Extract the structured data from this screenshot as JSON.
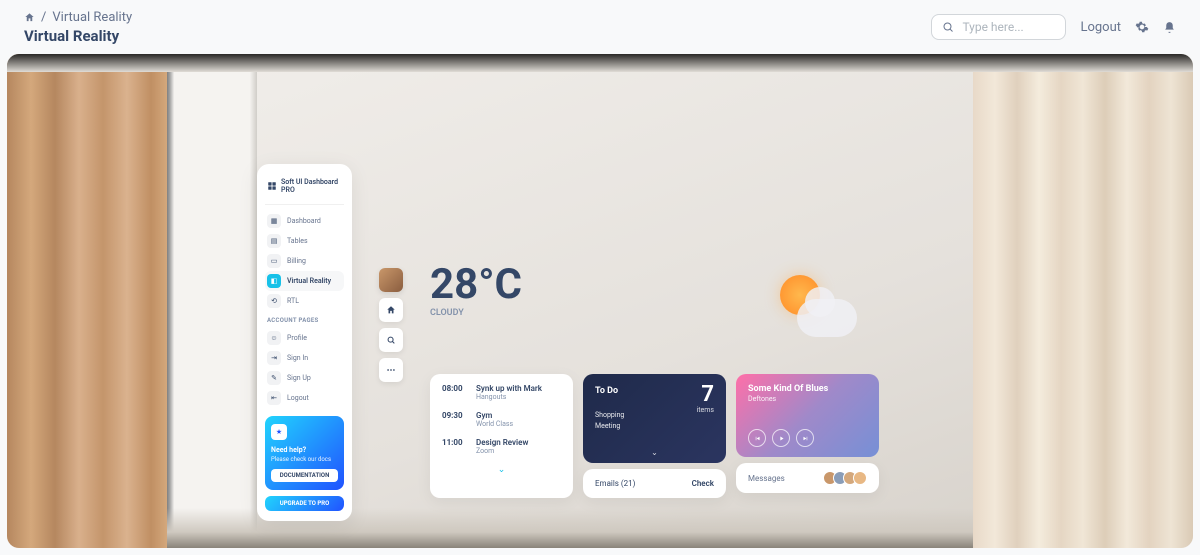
{
  "header": {
    "breadcrumb_current": "Virtual Reality",
    "page_title": "Virtual Reality",
    "search_placeholder": "Type here...",
    "logout": "Logout"
  },
  "sidebar": {
    "brand": "Soft UI Dashboard PRO",
    "items": [
      {
        "label": "Dashboard"
      },
      {
        "label": "Tables"
      },
      {
        "label": "Billing"
      },
      {
        "label": "Virtual Reality"
      },
      {
        "label": "RTL"
      }
    ],
    "account_heading": "ACCOUNT PAGES",
    "account_items": [
      {
        "label": "Profile"
      },
      {
        "label": "Sign In"
      },
      {
        "label": "Sign Up"
      },
      {
        "label": "Logout"
      }
    ],
    "help": {
      "title": "Need help?",
      "subtitle": "Please check our docs",
      "doc_btn": "DOCUMENTATION"
    },
    "upgrade": "UPGRADE TO PRO"
  },
  "weather": {
    "temperature": "28°C",
    "condition": "CLOUDY"
  },
  "schedule": [
    {
      "time": "08:00",
      "title": "Synk up with Mark",
      "sub": "Hangouts"
    },
    {
      "time": "09:30",
      "title": "Gym",
      "sub": "World Class"
    },
    {
      "time": "11:00",
      "title": "Design Review",
      "sub": "Zoom"
    }
  ],
  "todo": {
    "title": "To Do",
    "count": "7",
    "items_label": "items",
    "tasks": [
      "Shopping",
      "Meeting"
    ]
  },
  "emails": {
    "label": "Emails (21)",
    "action": "Check"
  },
  "music": {
    "title": "Some Kind Of Blues",
    "artist": "Deftones"
  },
  "messages": {
    "label": "Messages"
  }
}
